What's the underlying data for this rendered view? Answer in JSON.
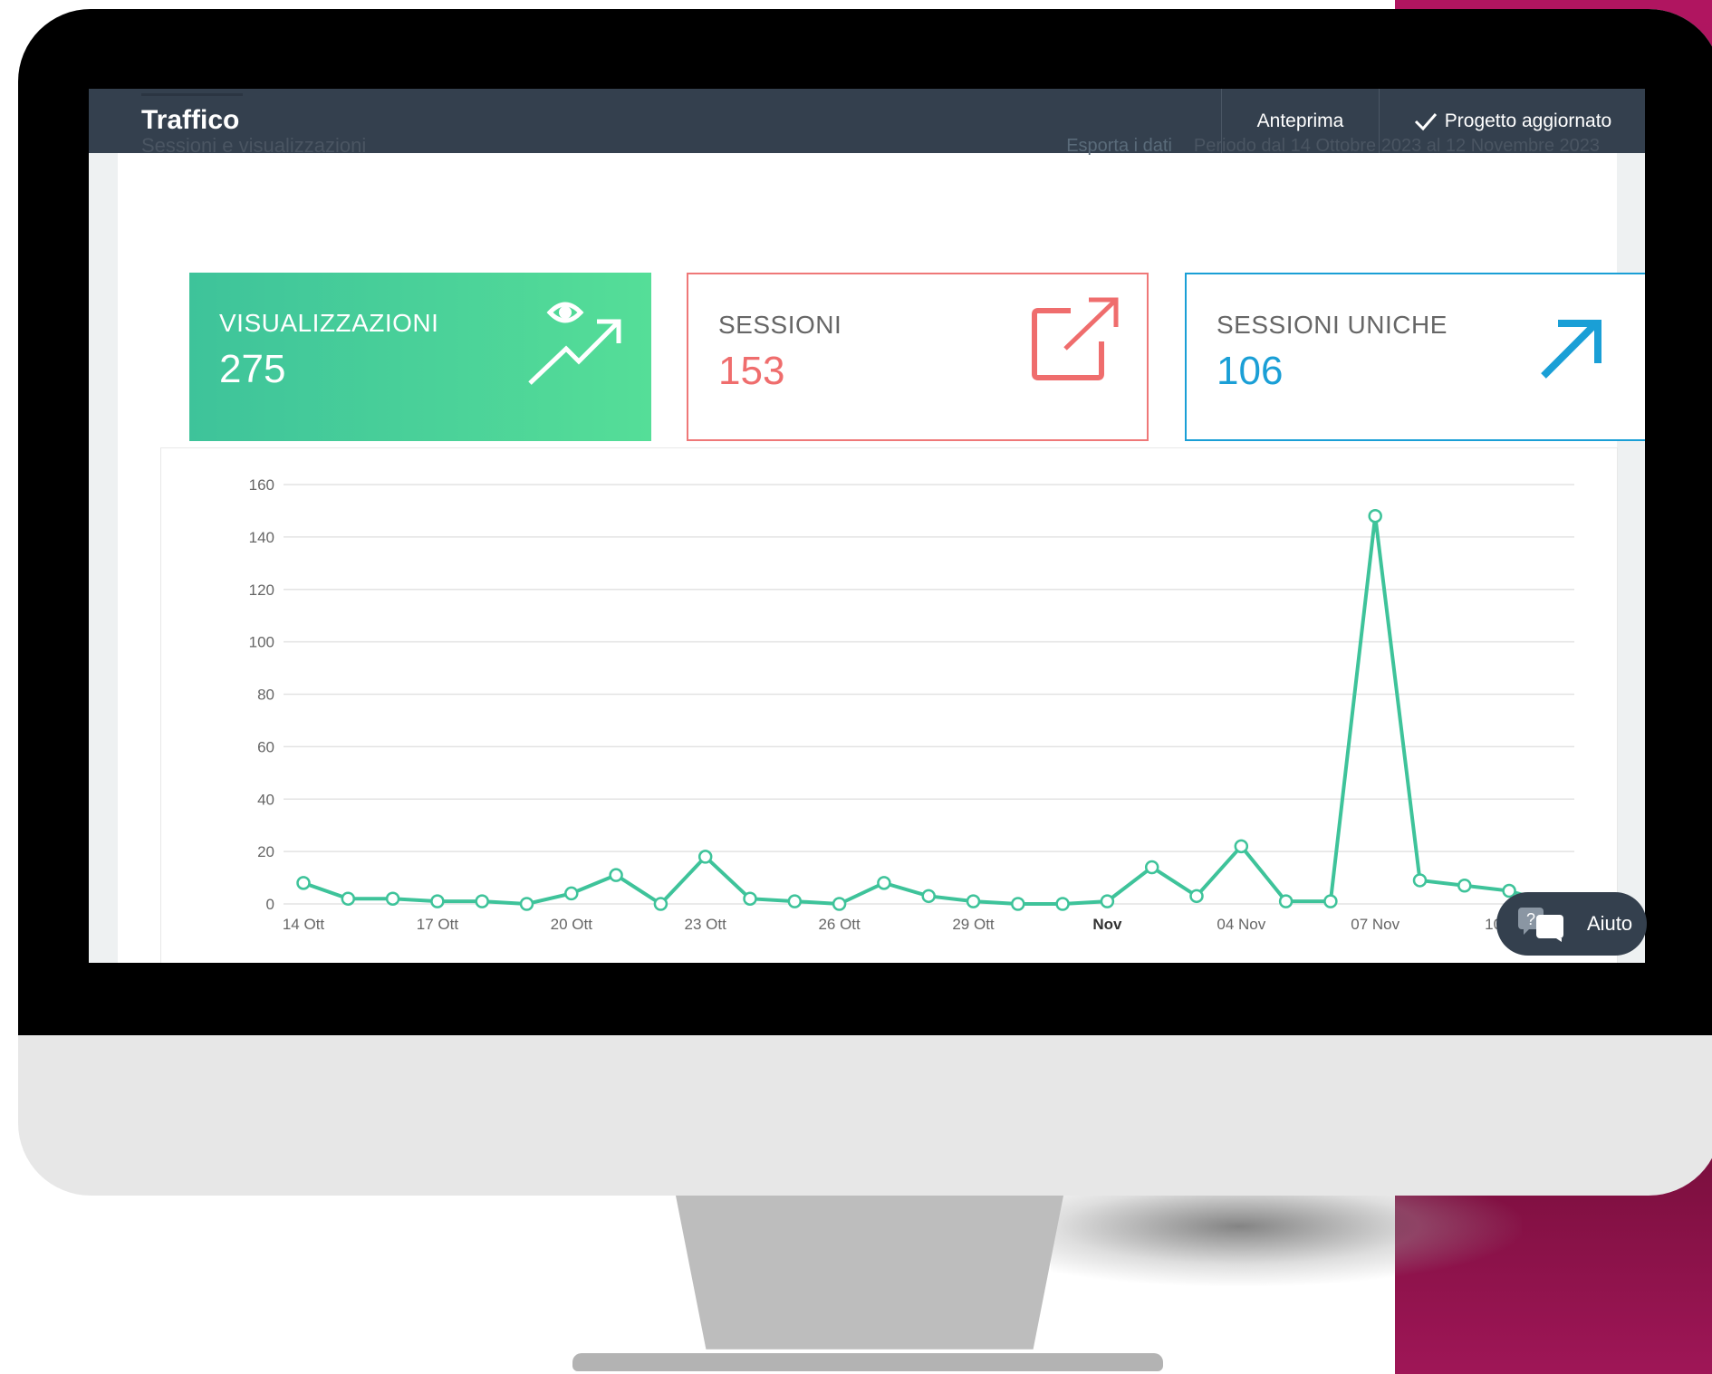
{
  "header": {
    "title": "Traffico",
    "subtitle": "Sessioni e visualizzazioni",
    "export_label": "Esporta i dati",
    "period_label": "Periodo dal 14 Ottobre 2023 al 12 Novembre 2023",
    "preview_label": "Anteprima",
    "saved_label": "Progetto aggiornato",
    "saved_icon": "check-icon"
  },
  "cards": {
    "views": {
      "label": "VISUALIZZAZIONI",
      "value": "275",
      "icon": "eye-trend-icon",
      "color": "#3ec39a"
    },
    "sessions": {
      "label": "SESSIONI",
      "value": "153",
      "icon": "external-link-icon",
      "color": "#ef6d6d"
    },
    "unique": {
      "label": "SESSIONI UNICHE",
      "value": "106",
      "icon": "arrow-up-right-icon",
      "color": "#1a9fd6"
    }
  },
  "help": {
    "label": "Aiuto",
    "icon": "chat-help-icon"
  },
  "chart_data": {
    "type": "line",
    "x": [
      "14 Ott",
      "15 Ott",
      "16 Ott",
      "17 Ott",
      "18 Ott",
      "19 Ott",
      "20 Ott",
      "21 Ott",
      "22 Ott",
      "23 Ott",
      "24 Ott",
      "25 Ott",
      "26 Ott",
      "27 Ott",
      "28 Ott",
      "29 Ott",
      "30 Ott",
      "31 Ott",
      "01 Nov",
      "02 Nov",
      "03 Nov",
      "04 Nov",
      "05 Nov",
      "06 Nov",
      "07 Nov",
      "08 Nov",
      "09 Nov",
      "10 Nov",
      "11 Nov"
    ],
    "series": [
      {
        "values": [
          8,
          2,
          2,
          1,
          1,
          0,
          4,
          11,
          0,
          18,
          2,
          1,
          0,
          8,
          3,
          1,
          0,
          0,
          1,
          14,
          3,
          22,
          1,
          1,
          148,
          9,
          7,
          5,
          0
        ],
        "color": "#3ec39a"
      }
    ],
    "x_tick_labels": [
      "14 Ott",
      "17 Ott",
      "20 Ott",
      "23 Ott",
      "26 Ott",
      "29 Ott",
      "Nov",
      "04 Nov",
      "07 Nov",
      "10 Nov"
    ],
    "x_tick_index": [
      0,
      3,
      6,
      9,
      12,
      15,
      18,
      21,
      24,
      27
    ],
    "y_ticks": [
      0,
      20,
      40,
      60,
      80,
      100,
      120,
      140,
      160
    ],
    "ylim": [
      0,
      160
    ],
    "grid": true
  }
}
